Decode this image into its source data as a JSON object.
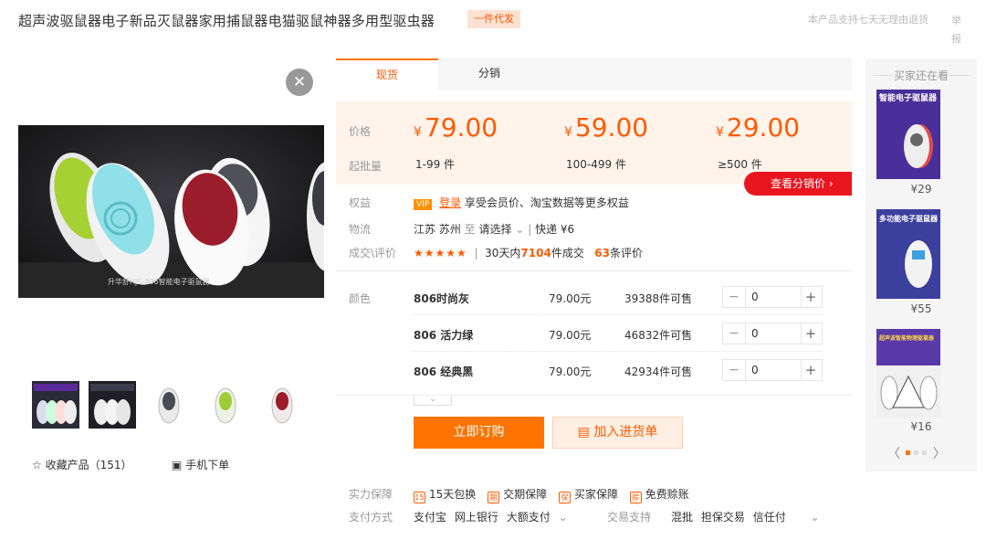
{
  "header": {
    "title": "超声波驱鼠器电子新品灭鼠器家用捕鼠器电猫驱鼠神器多用型驱虫器",
    "badge": "一件代发",
    "notice": "本产品支持七天无理由退货",
    "report": "举报"
  },
  "gallery": {
    "close": "✕",
    "caption": "升华舒HJS-806智能电子驱鼠器",
    "favorite": "☆ 收藏产品（151）",
    "mobile_order": "手机下单"
  },
  "tabs": [
    "现货",
    "分销"
  ],
  "price_box": {
    "price_label": "价格",
    "batch_label": "起批量",
    "currency": "¥",
    "tiers": [
      {
        "price": "79.00",
        "batch": "1-99 件"
      },
      {
        "price": "59.00",
        "batch": "100-499 件"
      },
      {
        "price": "29.00",
        "batch": "≥500 件"
      }
    ],
    "distribution_button": "查看分销价  ›"
  },
  "info": {
    "benefits_label": "权益",
    "vip": "VIP",
    "login": "登录",
    "benefits_text": "享受会员价、淘宝数据等更多权益",
    "logistics_label": "物流",
    "origin": "江苏 苏州",
    "to": "至",
    "select": "请选择",
    "shipping": "快递 ¥6",
    "deals_label": "成交\\评价",
    "stars": "★★★★★",
    "days": "30天内",
    "deals_count": "7104",
    "deals_suffix": "件成交",
    "reviews_count": "63",
    "reviews_suffix": "条评价"
  },
  "sku": {
    "color_label": "颜色",
    "items": [
      {
        "name": "806时尚灰",
        "price": "79.00元",
        "stock": "39388件可售",
        "qty": "0"
      },
      {
        "name": "806 活力绿",
        "price": "79.00元",
        "stock": "46832件可售",
        "qty": "0"
      },
      {
        "name": "806 经典黑",
        "price": "79.00元",
        "stock": "42934件可售",
        "qty": "0"
      }
    ]
  },
  "actions": {
    "order": "立即订购",
    "cart": "加入进货单"
  },
  "guarantee": {
    "label": "实力保障",
    "items": [
      "15天包换",
      "交期保障",
      "买家保障",
      "免费赊账"
    ],
    "pay_label": "支付方式",
    "pay_methods": [
      "支付宝",
      "网上银行",
      "大额支付"
    ],
    "trade_label": "交易支持",
    "trade_methods": [
      "混批",
      "担保交易",
      "信任付"
    ]
  },
  "sidebar": {
    "title": "买家还在看",
    "items": [
      {
        "price": "¥29",
        "banner": "智能电子驱鼠器"
      },
      {
        "price": "¥55",
        "banner": "多功能电子驱鼠器"
      },
      {
        "price": "¥16",
        "banner": "超声波智能物理驱鼠器"
      }
    ]
  },
  "colors": {
    "accent": "#ff5a00",
    "button": "#ff7300",
    "distribution": "#e8151f",
    "price_bg": "#fff3ea"
  }
}
